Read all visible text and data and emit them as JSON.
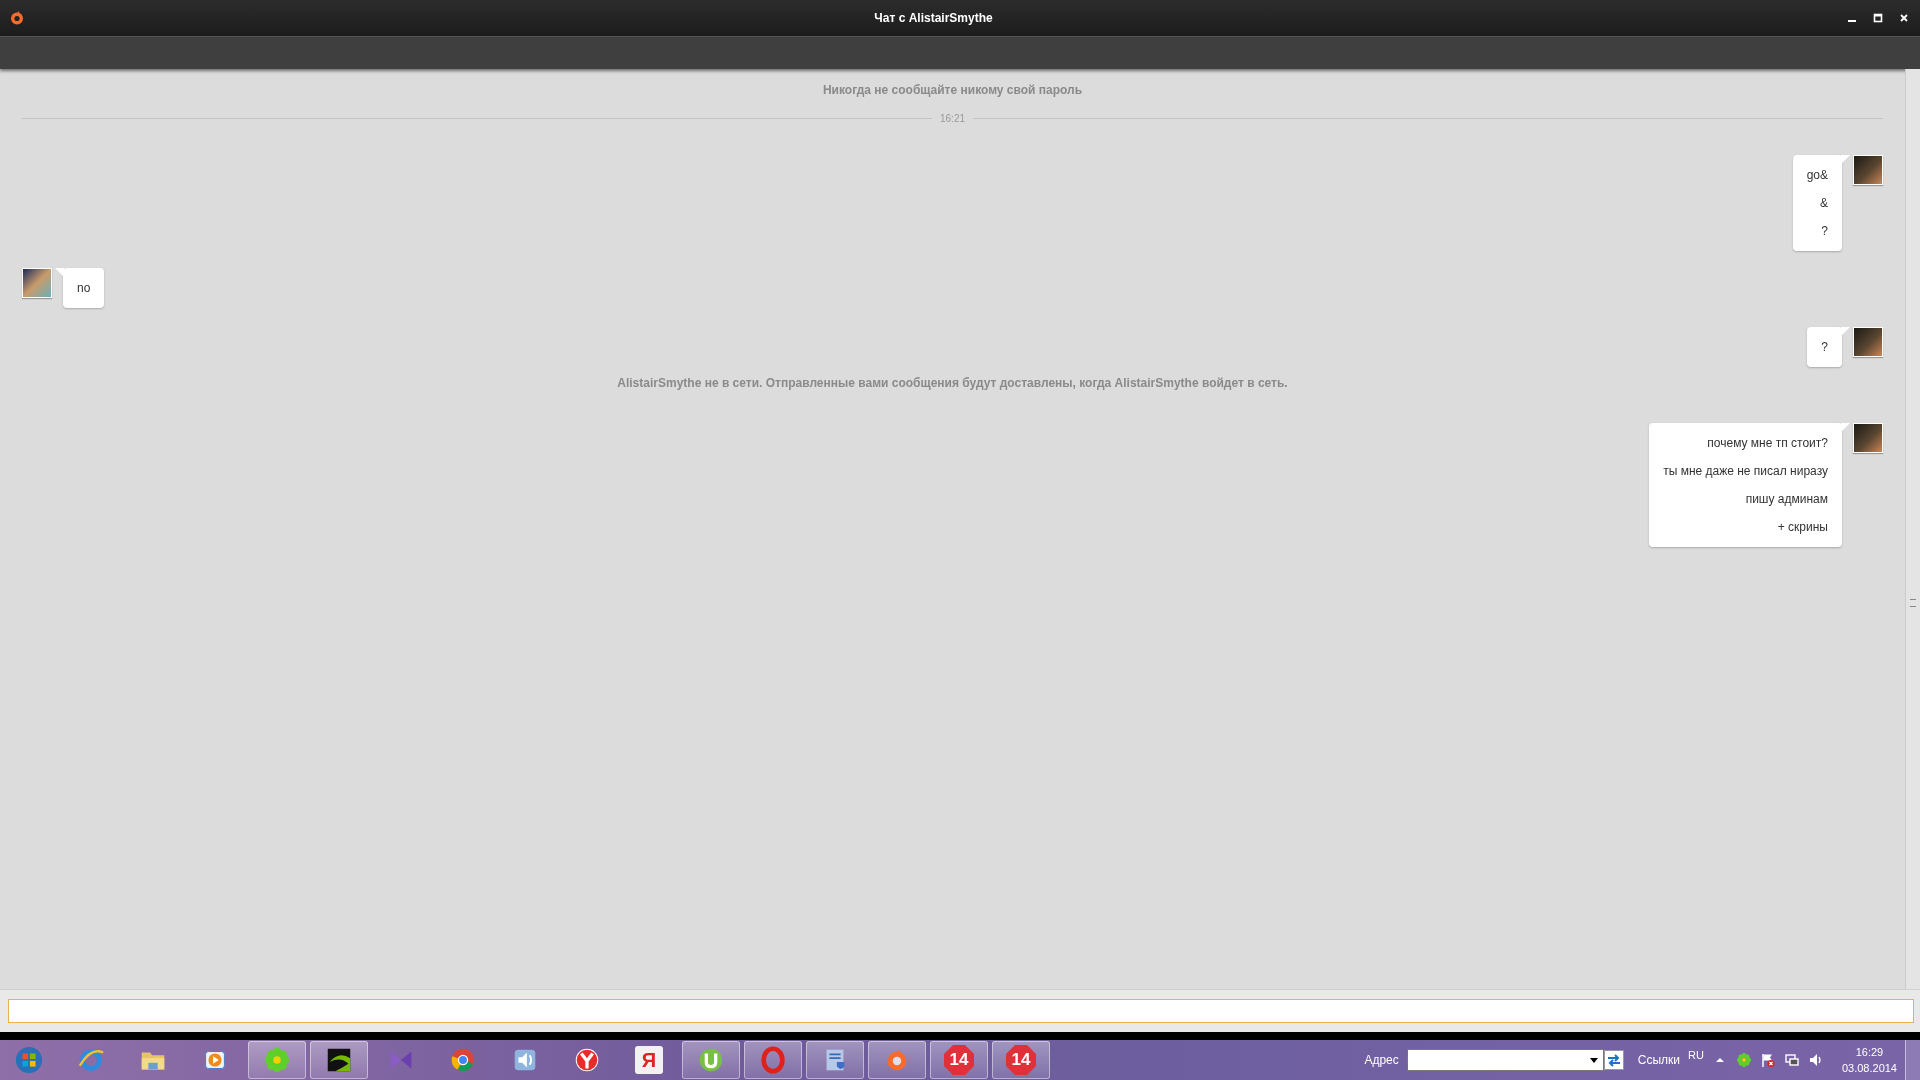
{
  "window": {
    "title": "Чат с AlistairSmythe"
  },
  "chat": {
    "notice": "Никогда не сообщайте никому свой пароль",
    "divider_time": "16:21",
    "entries": [
      {
        "kind": "message",
        "outgoing": true,
        "lines": [
          "go&",
          "&",
          "?"
        ]
      },
      {
        "kind": "message",
        "outgoing": false,
        "lines": [
          "no"
        ]
      },
      {
        "kind": "message",
        "outgoing": true,
        "lines": [
          "?"
        ]
      },
      {
        "kind": "system",
        "text": "AlistairSmythe не в сети. Отправленные вами сообщения будут доставлены, когда AlistairSmythe войдет в сеть."
      },
      {
        "kind": "message",
        "outgoing": true,
        "lines": [
          "почему мне тп стоит?",
          "ты мне даже не писал ниразу",
          "пишу админам",
          "+ скрины"
        ]
      }
    ]
  },
  "taskbar": {
    "apps": [
      {
        "kind": "orb",
        "running": false
      },
      {
        "kind": "ring",
        "running": false
      },
      {
        "kind": "folder",
        "running": false
      },
      {
        "kind": "media",
        "running": false
      },
      {
        "kind": "flower",
        "running": true
      },
      {
        "kind": "nvidia",
        "running": true
      },
      {
        "kind": "bow",
        "running": false
      },
      {
        "kind": "chrome",
        "running": false
      },
      {
        "kind": "speaker",
        "running": false
      },
      {
        "kind": "ybrowser",
        "running": false
      },
      {
        "kind": "letter",
        "label": "Я",
        "running": false
      },
      {
        "kind": "utorrent",
        "running": true
      },
      {
        "kind": "opera",
        "running": true
      },
      {
        "kind": "installer",
        "running": true
      },
      {
        "kind": "origin",
        "running": true
      },
      {
        "kind": "badge",
        "label": "14",
        "running": true
      },
      {
        "kind": "badge",
        "label": "14",
        "running": true
      }
    ],
    "address_label": "Адрес",
    "links_label": "Ссылки",
    "language": "RU",
    "time": "16:29",
    "date": "03.08.2014"
  }
}
